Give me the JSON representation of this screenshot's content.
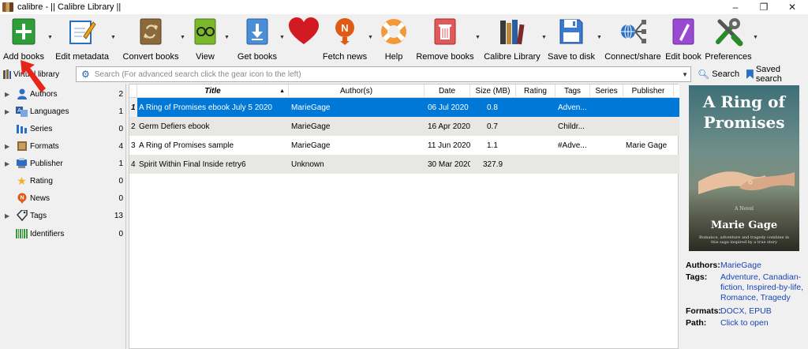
{
  "window": {
    "title": "calibre - || Calibre Library ||"
  },
  "window_controls": {
    "minimize": "–",
    "maximize": "❐",
    "close": "✕"
  },
  "toolbar": {
    "add_books": "Add books",
    "edit_metadata": "Edit metadata",
    "convert_books": "Convert books",
    "view": "View",
    "get_books": "Get books",
    "fetch_news": "Fetch news",
    "help": "Help",
    "remove_books": "Remove books",
    "calibre_library": "Calibre Library",
    "save_to_disk": "Save to disk",
    "connect_share": "Connect/share",
    "edit_book": "Edit book",
    "preferences": "Preferences"
  },
  "search": {
    "virtual_library_label": "Virtual library",
    "placeholder": "Search (For advanced search click the gear icon to the left)",
    "search_button": "Search",
    "saved_search_button": "Saved search"
  },
  "tag_browser": {
    "items": [
      {
        "label": "Authors",
        "count": "2",
        "icon": "person-icon",
        "expandable": true
      },
      {
        "label": "Languages",
        "count": "1",
        "icon": "languages-icon",
        "expandable": true
      },
      {
        "label": "Series",
        "count": "0",
        "icon": "series-icon",
        "expandable": false
      },
      {
        "label": "Formats",
        "count": "4",
        "icon": "formats-icon",
        "expandable": true
      },
      {
        "label": "Publisher",
        "count": "1",
        "icon": "publisher-icon",
        "expandable": true
      },
      {
        "label": "Rating",
        "count": "0",
        "icon": "star-icon",
        "expandable": false
      },
      {
        "label": "News",
        "count": "0",
        "icon": "news-icon",
        "expandable": false
      },
      {
        "label": "Tags",
        "count": "13",
        "icon": "tag-icon",
        "expandable": true
      },
      {
        "label": "Identifiers",
        "count": "0",
        "icon": "barcode-icon",
        "expandable": false
      }
    ]
  },
  "table": {
    "columns": [
      "Title",
      "Author(s)",
      "Date",
      "Size (MB)",
      "Rating",
      "Tags",
      "Series",
      "Publisher"
    ],
    "sort_indicator": "▲",
    "rows": [
      {
        "num": "1",
        "title": "A Ring of Promises ebook July 5 2020",
        "author": "MarieGage",
        "date": "06 Jul 2020",
        "size": "0.8",
        "rating": "",
        "tags": "Adven...",
        "series": "",
        "publisher": ""
      },
      {
        "num": "2",
        "title": "Germ Defiers ebook",
        "author": "MarieGage",
        "date": "16 Apr 2020",
        "size": "0.7",
        "rating": "",
        "tags": "Childr...",
        "series": "",
        "publisher": ""
      },
      {
        "num": "3",
        "title": "A Ring of Promises sample",
        "author": "MarieGage",
        "date": "11 Jun 2020",
        "size": "1.1",
        "rating": "",
        "tags": "#Adve...",
        "series": "",
        "publisher": "Marie Gage"
      },
      {
        "num": "4",
        "title": "Spirit Within Final Inside retry6",
        "author": "Unknown",
        "date": "30 Mar 2020",
        "size": "327.9",
        "rating": "",
        "tags": "",
        "series": "",
        "publisher": ""
      }
    ]
  },
  "cover": {
    "title": "A Ring of Promises",
    "subtitle": "A Novel",
    "author": "Marie Gage",
    "tagline": "Romance, adventure and tragedy combine in this saga inspired by a true story"
  },
  "details": {
    "authors_label": "Authors:",
    "authors_value": "MarieGage",
    "tags_label": "Tags:",
    "tags_value": "Adventure, Canadian-fiction, Inspired-by-life, Romance, Tragedy",
    "formats_label": "Formats:",
    "formats_value": "DOCX, EPUB",
    "path_label": "Path:",
    "path_value": "Click to open"
  },
  "colors": {
    "selection": "#0078d7",
    "link": "#1a44b8",
    "arrow": "#e8231a"
  }
}
